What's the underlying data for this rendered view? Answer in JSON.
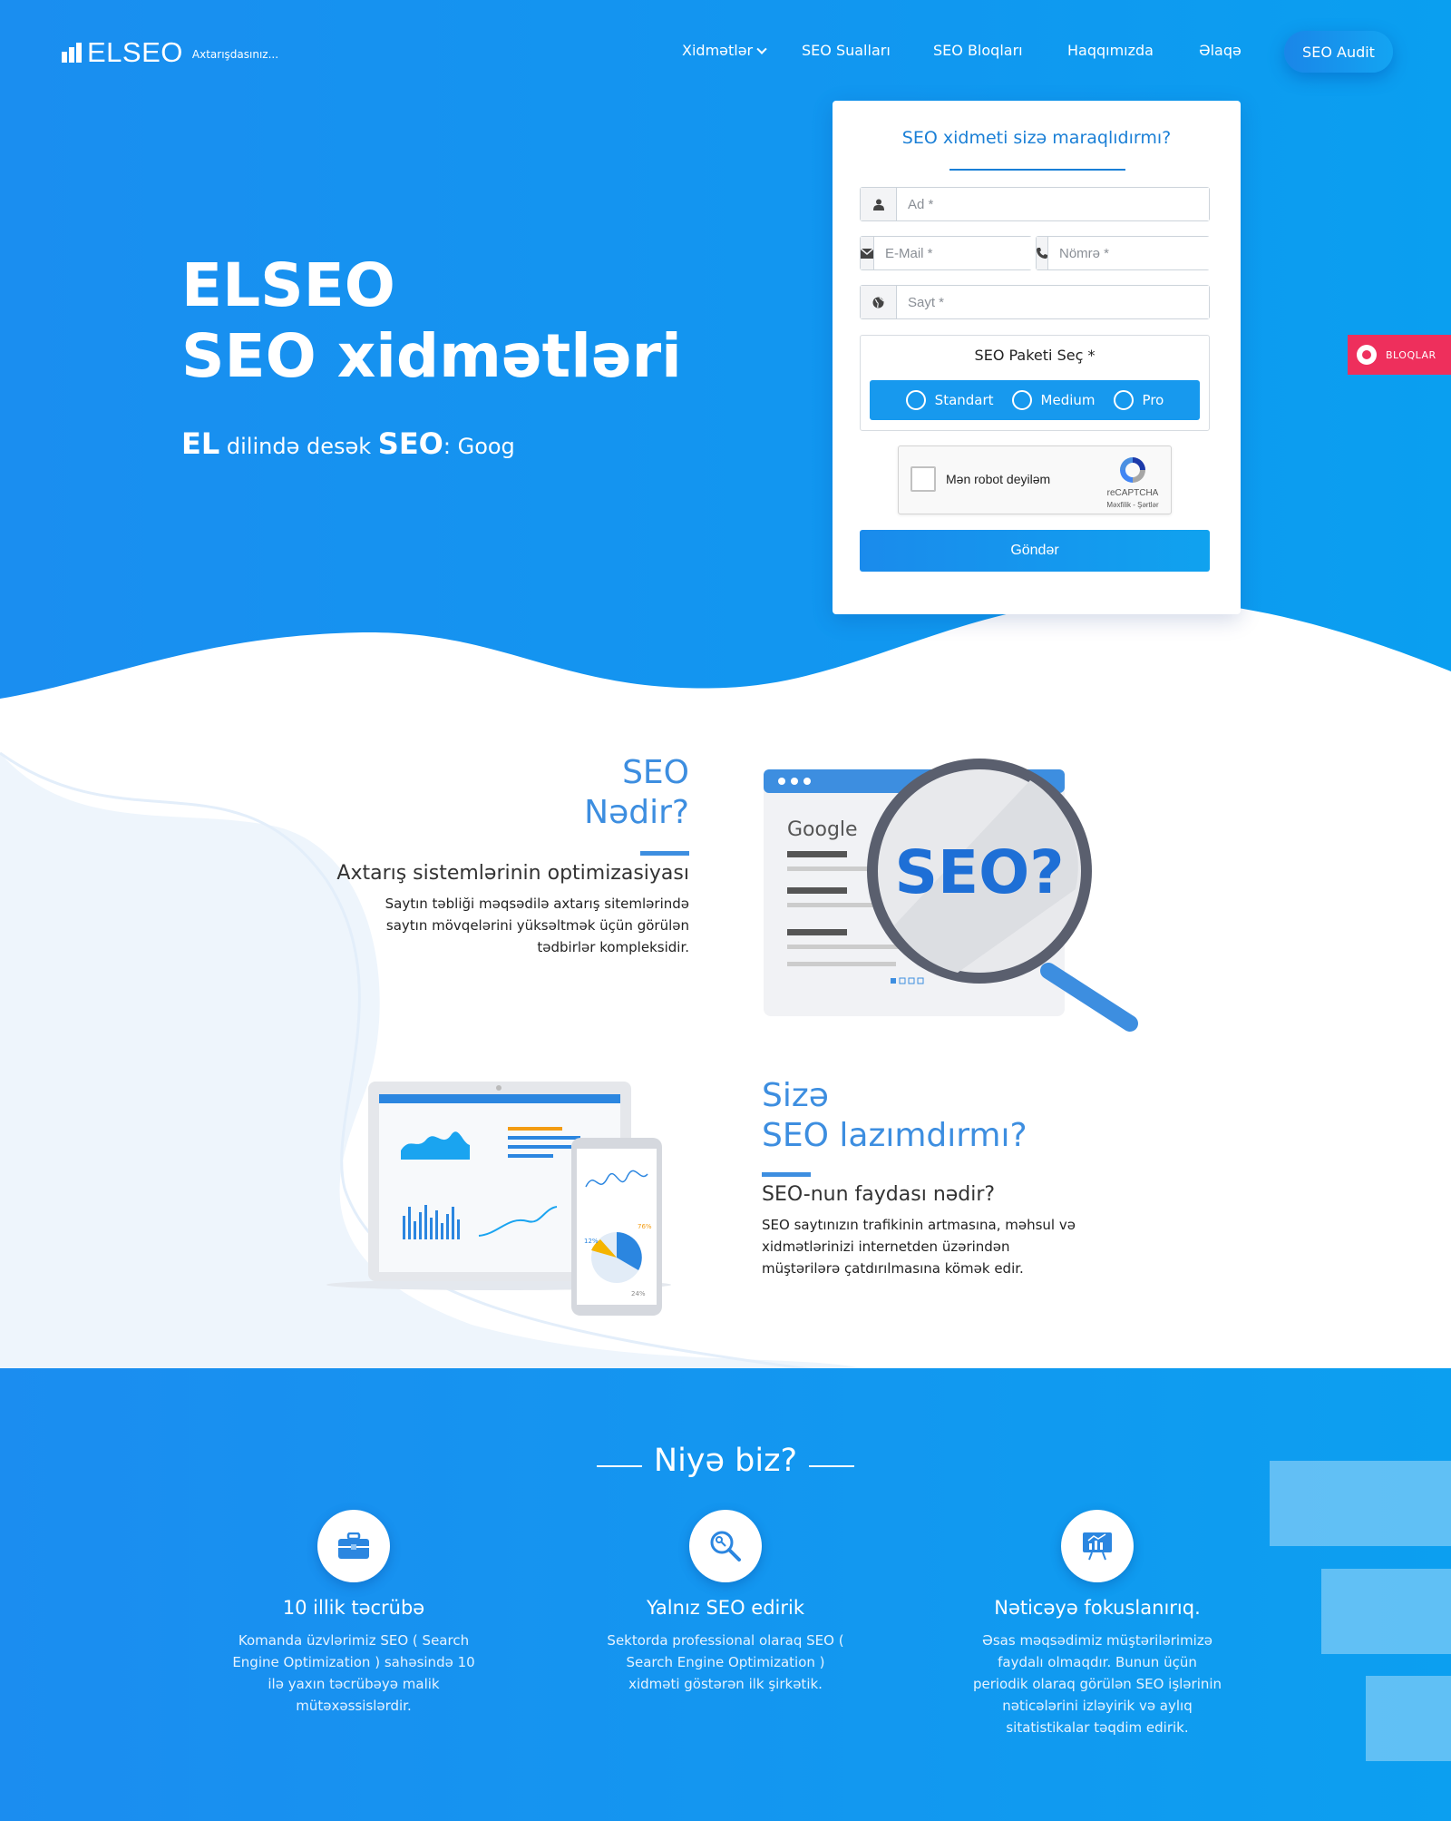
{
  "brand": {
    "logo": "ELSEO",
    "tagline": "Axtarışdasınız..."
  },
  "nav": {
    "items": [
      "Xidmətlər",
      "SEO Sualları",
      "SEO Bloqları",
      "Haqqımızda",
      "Əlaqə"
    ],
    "cta": "SEO Audit"
  },
  "hero": {
    "title_line1": "ELSEO",
    "title_line2": "SEO xidmətləri",
    "sub_el": "EL",
    "sub_mid": " dilində desək ",
    "sub_seo": "SEO",
    "sub_end": ": Goog"
  },
  "form": {
    "title": "SEO xidmeti sizə maraqlıdırmı?",
    "name_placeholder": "Ad *",
    "email_placeholder": "E-Mail *",
    "phone_placeholder": "Nömrə *",
    "site_placeholder": "Sayt *",
    "package_title": "SEO Paketi Seç *",
    "packages": [
      "Standart",
      "Medium",
      "Pro"
    ],
    "captcha_label": "Mən robot deyiləm",
    "captcha_brand": "reCAPTCHA",
    "captcha_terms": "Məxfilik - Şərtlər",
    "submit": "Göndər"
  },
  "side_tab": {
    "label": "BLOQLAR"
  },
  "what_is": {
    "title_line1": "SEO",
    "title_line2": "Nədir?",
    "subtitle": "Axtarış sistemlərinin optimizasiyası",
    "text": "Saytın təbliği məqsədilə axtarış sitemlərində saytın mövqelərini yüksəltmək üçün görülən tədbirlər kompleksidir.",
    "illustration_brand": "Google",
    "illustration_text": "SEO?"
  },
  "need": {
    "title_line1": "Sizə",
    "title_line2": "SEO lazımdırmı?",
    "subtitle": "SEO-nun faydası nədir?",
    "text": "SEO saytınızın trafikinin artmasına, məhsul və xidmətlərinizi internetden üzərindən müştərilərə çatdırılmasına kömək edir.",
    "phone_pct_1": "76%",
    "phone_pct_2": "12%",
    "phone_pct_3": "24%"
  },
  "why": {
    "title": "Niyə biz?",
    "features": [
      {
        "icon": "briefcase-icon",
        "title": "10 illik təcrübə",
        "text": "Komanda üzvlərimiz SEO ( Search Engine Optimization ) sahəsində 10 ilə yaxın təcrübəyə malik mütəxəssislərdir."
      },
      {
        "icon": "search-key-icon",
        "title": "Yalnız SEO edirik",
        "text": "Sektorda professional olaraq SEO ( Search Engine Optimization ) xidməti göstərən ilk şirkətik."
      },
      {
        "icon": "presentation-chart-icon",
        "title": "Nəticəyə fokuslanırıq.",
        "text": "Əsas məqsədimiz müştərilərimizə faydalı olmaqdır. Bunun üçün periodik olaraq görülən SEO işlərinin nəticələrini izləyirik və aylıq sitatistikalar təqdim edirik."
      }
    ]
  },
  "colors": {
    "primary": "#1a8ef0",
    "heading": "#3d8ee0",
    "accent_red": "#ee2f5c"
  }
}
